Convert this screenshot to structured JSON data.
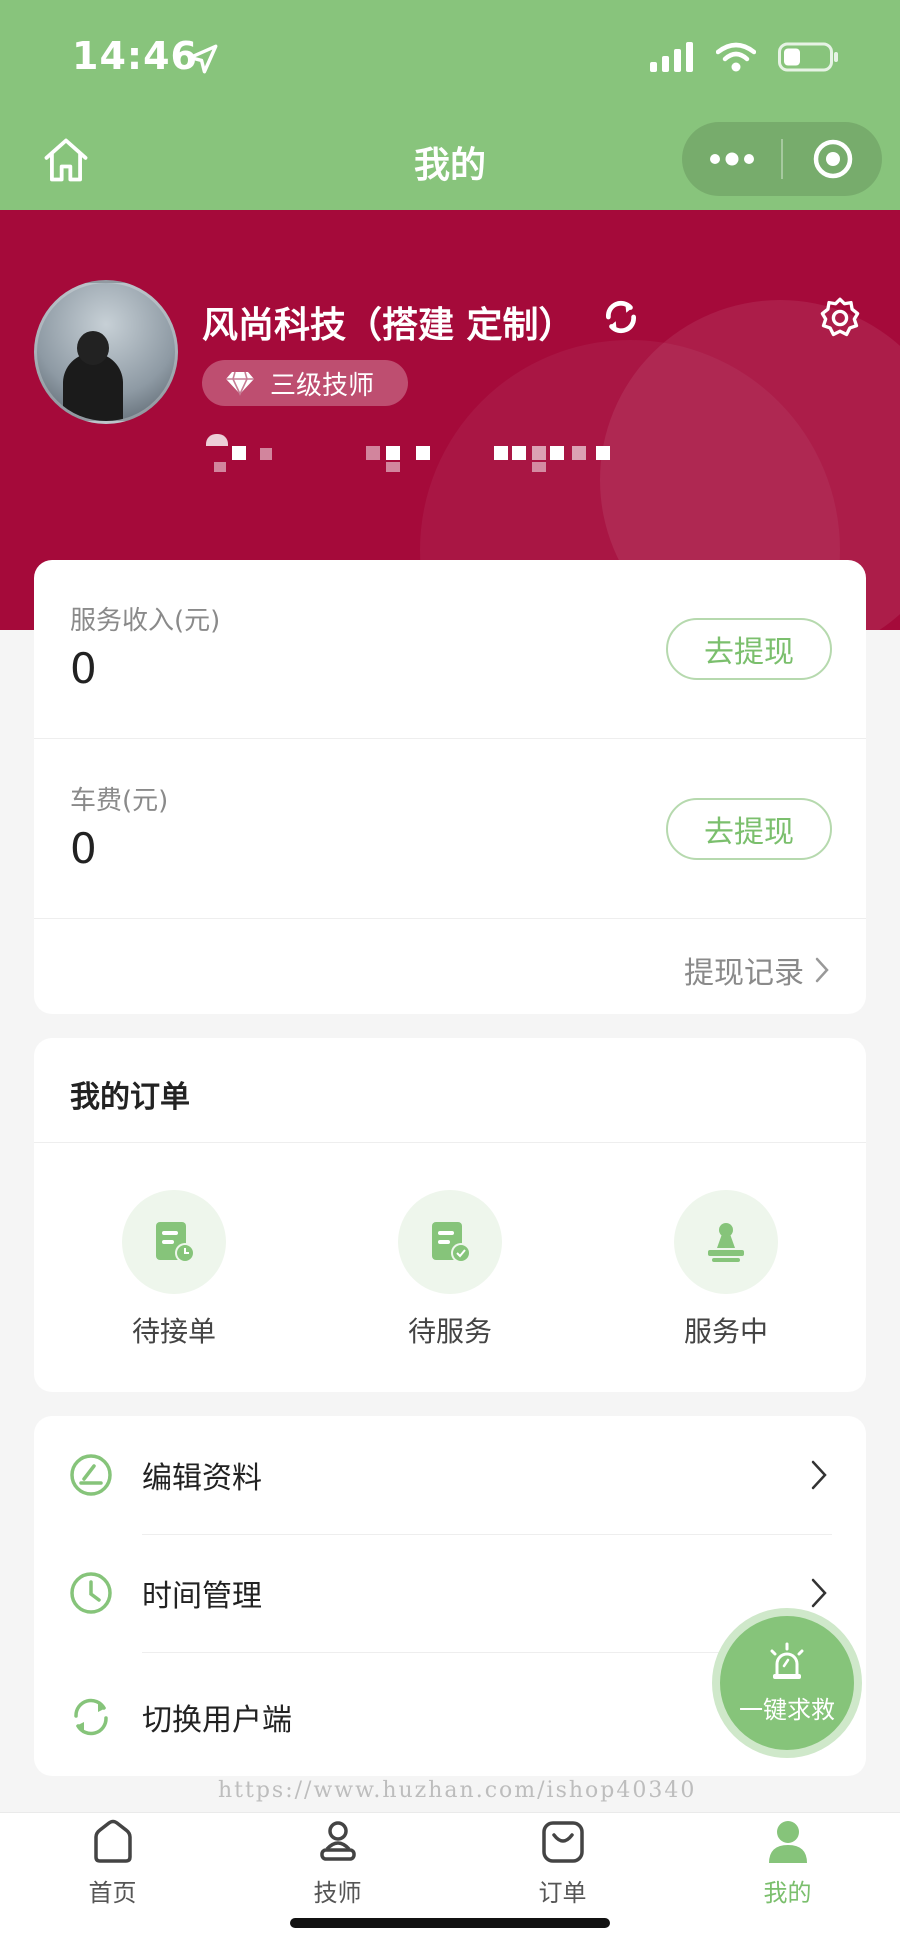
{
  "status_bar": {
    "time": "14:46"
  },
  "nav": {
    "title": "我的"
  },
  "profile": {
    "name": "风尚科技（搭建 定制）",
    "level": "三级技师"
  },
  "income": {
    "service_label": "服务收入(元)",
    "service_value": "0",
    "car_label": "车费(元)",
    "car_value": "0",
    "withdraw_label": "去提现",
    "record_label": "提现记录"
  },
  "orders": {
    "title": "我的订单",
    "items": [
      {
        "label": "待接单",
        "icon": "pending-order-icon"
      },
      {
        "label": "待服务",
        "icon": "to-serve-icon"
      },
      {
        "label": "服务中",
        "icon": "in-service-icon"
      }
    ]
  },
  "menu": {
    "items": [
      {
        "label": "编辑资料",
        "icon": "edit-icon"
      },
      {
        "label": "时间管理",
        "icon": "clock-icon"
      },
      {
        "label": "切换用户端",
        "icon": "switch-icon"
      }
    ]
  },
  "sos": {
    "label": "一键求救"
  },
  "watermark": "https://www.huzhan.com/ishop40340",
  "tabbar": {
    "items": [
      {
        "label": "首页"
      },
      {
        "label": "技师"
      },
      {
        "label": "订单"
      },
      {
        "label": "我的"
      }
    ],
    "active_index": 3
  },
  "colors": {
    "top_green": "#88c47c",
    "header_red": "#a50a3a",
    "accent_green": "#7bbf6d"
  }
}
